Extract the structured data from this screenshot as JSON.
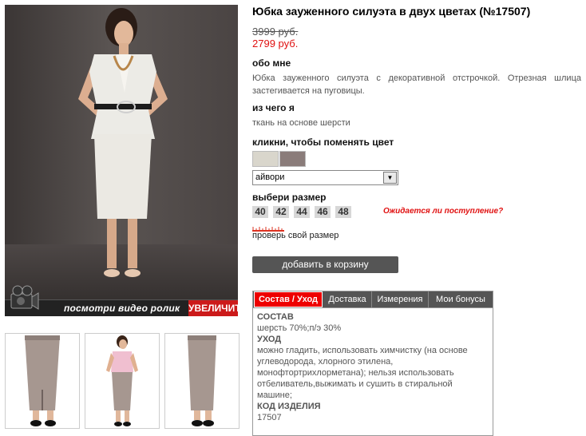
{
  "product": {
    "title": "Юбка зауженного силуэта в двух цветах (№17507)",
    "old_price": "3999 руб.",
    "new_price": "2799 руб."
  },
  "gallery": {
    "video_label": "посмотри видео ролик",
    "zoom_label": "УВЕЛИЧИТЬ"
  },
  "about": {
    "heading": "обо мне",
    "text": "Юбка зауженного силуэта с декоративной отстрочкой. Отрезная шлица застегивается на пуговицы."
  },
  "material": {
    "heading": "из чего я",
    "text": "ткань на основе шерсти"
  },
  "color": {
    "heading": "кликни, чтобы поменять цвет",
    "swatches": [
      "#d9d6cc",
      "#8a7c7a"
    ],
    "selected": "айвори"
  },
  "size": {
    "heading": "выбери размер",
    "options": [
      "40",
      "42",
      "44",
      "46",
      "48"
    ],
    "expected_label": "Ожидается ли поступление?",
    "check_label": "проверь свой размер"
  },
  "cart": {
    "label": "добавить в корзину"
  },
  "tabs": {
    "items": [
      "Состав / Уход",
      "Доставка",
      "Измерения",
      "Мои бонусы"
    ],
    "panel": {
      "composition_heading": "СОСТАВ",
      "composition": "шерсть 70%;п/э 30%",
      "care_heading": "УХОД",
      "care": "можно гладить, использовать химчистку (на основе углеводорода, хлорного этилена, монофтортрихлорметана); нельзя использовать отбеливатель,выжимать и сушить в стиральной машине;",
      "code_heading": "КОД ИЗДЕЛИЯ",
      "code": "17507"
    }
  },
  "colors": {
    "accent": "#e01010",
    "button": "#555555"
  }
}
